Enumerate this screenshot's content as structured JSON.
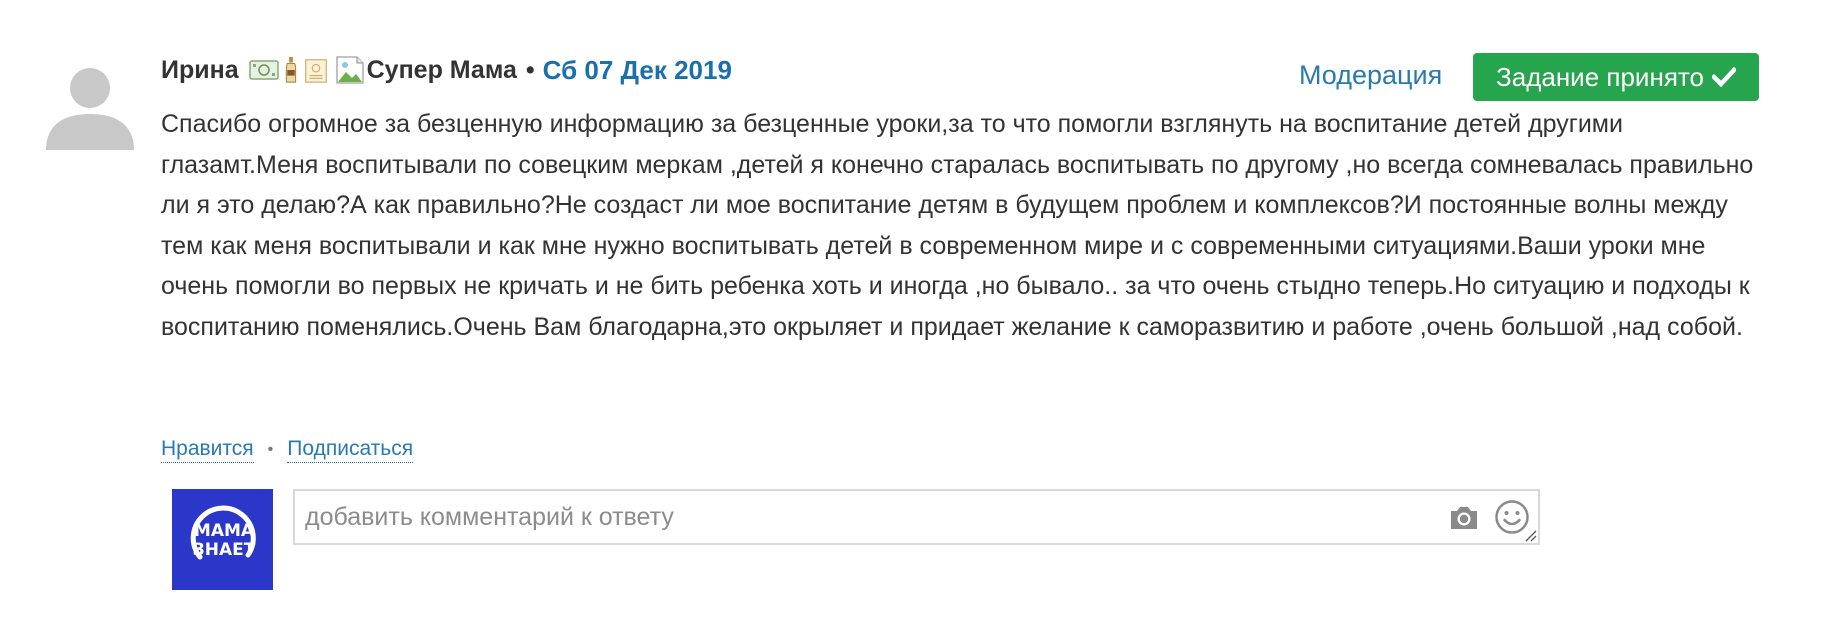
{
  "comment": {
    "author": "Ирина",
    "rank": "Супер Мама",
    "separator": "•",
    "date": "Сб 07 Дек 2019",
    "moderation_label": "Модерация",
    "status_button_label": "Задание принято",
    "badges": [
      "money-badge-icon",
      "bottle-badge-icon",
      "certificate-badge-icon",
      "broken-image-icon"
    ],
    "text": "Спасибо огромное за безценную информацию за безценные уроки,за то что помогли взглянуть на воспитание детей другими глазамт.Меня воспитывали по совецким меркам ,детей я конечно старалась воспитывать по другому ,но всегда сомневалась правильно ли я это делаю?А как правильно?Не создаст ли мое воспитание детям в будущем проблем и комплексов?И постоянные волны между тем как меня воспитывали и как мне нужно воспитывать детей в современном мире и с современными ситуациями.Ваши уроки мне очень помогли во первых не кричать и не бить ребенка хоть и иногда ,но бывало.. за что очень стыдно теперь.Но ситуацию и подходы к воспитанию поменялись.Очень Вам благодарна,это окрыляет и придает желание к саморазвитию и работе ,очень большой ,над собой."
  },
  "actions": {
    "like_label": "Нравится",
    "dot": "•",
    "subscribe_label": "Подписаться"
  },
  "reply": {
    "logo_text_line1": "МАМА",
    "logo_text_line2": "ЗНАЕТ",
    "placeholder": "добавить комментарий к ответу"
  },
  "colors": {
    "accent_link": "#1a6fad",
    "success_button": "#27a44e",
    "logo_background": "#2b37c8"
  }
}
